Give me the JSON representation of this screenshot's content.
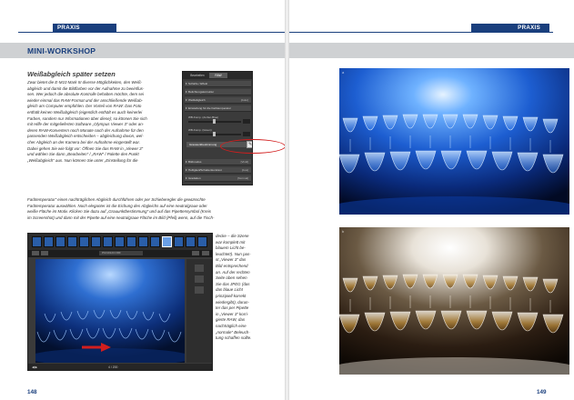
{
  "header": {
    "section_left": "PRAXIS",
    "section_right": "PRAXIS"
  },
  "left_page": {
    "band_title": "MINI-WORKSHOP",
    "heading": "Weißabgleich später setzen",
    "body_col1": [
      "Zwar bietet die E-M10 Mark III diverse Möglichkeiten, den Weiß-",
      "abgleich und damit die Bildfarben vor der Aufnahme zu beeinflus-",
      "sen. Wer jedoch die absolute Kontrolle behalten möchte, dem sei",
      "wieder einmal das RAW-Format und der anschließende Weißab-",
      "gleich am Computer empfohlen. Der Vorteil von RAW: Das Foto",
      "enthält keinen Weißabgleich (eigentlich enthält es auch keinerlei",
      "Farben, sondern nur Informationen über diese); so können Sie sich",
      "mit Hilfe der mitgelieferten Software „Olympus Viewer 3“ oder an-",
      "deren RAW-Konvertern noch Monate nach der Aufnahme für den",
      "passenden Weißabgleich entscheiden – abgleichung davon, wel-",
      "cher Abgleich an der Kamera bei der Aufnahme eingestellt war.",
      "Dabei gehen Sie wie folgt vor: Öffnen Sie das RAW in „Viewer 3“",
      "und wählen Sie dann „Bearbeiten“ / „RAW“ / Palette den Punkt",
      "„Weißabgleich“ aus. Nun können Sie unter „Einstellung für die"
    ],
    "body_wide": [
      "Farbtemperatur“ einen nachträglichen Abgleich durchführen oder per Schieberegler die gewünschte",
      "Farbtemperatur auswählen. Noch eleganter ist die Eichung des Abgleichs auf eine neutralgraue oder",
      "weiße Fläche im Motiv. Klicken Sie dazu auf „Grauunktbestimmung“ und auf das Pipettensymbol (Kreis",
      "im Screenshot) und dann mit der Pipette auf eine neutralgraue Fläche im Bild (Pfeil) wenn, auf die Tisch-"
    ],
    "body_narrow": [
      "decke – die Szene",
      "war komplett mit",
      "blauem Licht be-",
      "leuchtet!). Nun pas-",
      "st „Viewer 3“ das",
      "Bild entsprechend",
      "an. Auf der rechten",
      "Seite oben sehen",
      "Sie das JPEG (das",
      "das blaue Licht",
      "prinzipiell korrekt",
      "wiedergibt), darun-",
      "ter das per Pipette",
      "in „Viewer 3“ korri-",
      "gierte RAW, das",
      "nachträglich eine",
      "„normale“ Beleuch-",
      "tung schaffen sollte."
    ],
    "folio": "148",
    "panel": {
      "tabs": [
        "Bearbeiten",
        "RAW"
      ],
      "rows": [
        {
          "label": "Schärfe / Effekt",
          "value": ""
        },
        {
          "label": "Belichtungskorrektur",
          "value": ""
        },
        {
          "label": "Weißabgleich",
          "value": "[Auto]"
        },
        {
          "label": "Einstellung für die Farbtemperatur",
          "value": ""
        },
        {
          "label": "Bildmodus",
          "value": "[Vivid]"
        },
        {
          "label": "Helligkeit/Schattenkontrast",
          "value": "[Aus]"
        },
        {
          "label": "Gradation",
          "value": "[Normal]"
        }
      ],
      "sliders": [
        "WB-Komp. (Amber-Blue)",
        "WB-Komp. (Green)"
      ],
      "highlight_label": "Grauwerkbestimmung",
      "eyedropper_glyph": "✎",
      "highlight_color": "#d21e1e"
    },
    "viewer": {
      "filename": "P1010123.ORF",
      "footer_left": "◀ ▶",
      "footer_right": "4 / 200",
      "arrow_color": "#d21e1e"
    }
  },
  "right_page": {
    "photo_top_label": "a",
    "photo_bottom_label": "b",
    "folio": "149"
  },
  "colors": {
    "brand_blue": "#1a3f7d",
    "band_grey": "#cfd1d3"
  }
}
